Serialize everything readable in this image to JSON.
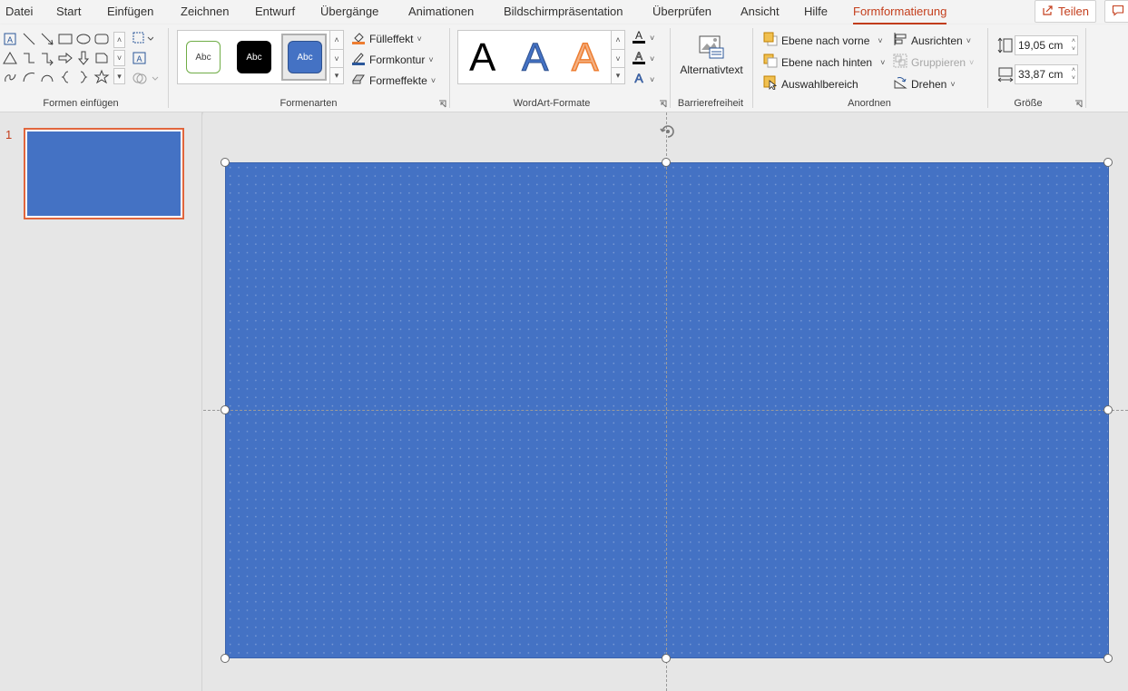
{
  "menu": {
    "tabs": [
      {
        "id": "datei",
        "label": "Datei"
      },
      {
        "id": "start",
        "label": "Start"
      },
      {
        "id": "einfuegen",
        "label": "Einfügen"
      },
      {
        "id": "zeichnen",
        "label": "Zeichnen"
      },
      {
        "id": "entwurf",
        "label": "Entwurf"
      },
      {
        "id": "uebergaenge",
        "label": "Übergänge"
      },
      {
        "id": "animationen",
        "label": "Animationen"
      },
      {
        "id": "bildschirm",
        "label": "Bildschirmpräsentation"
      },
      {
        "id": "ueberpruefen",
        "label": "Überprüfen"
      },
      {
        "id": "ansicht",
        "label": "Ansicht"
      },
      {
        "id": "hilfe",
        "label": "Hilfe"
      },
      {
        "id": "formformatierung",
        "label": "Formformatierung",
        "active": true
      }
    ],
    "share_label": "Teilen",
    "share_icon": "share-icon",
    "comment_icon": "comment-icon"
  },
  "ribbon": {
    "groups": {
      "formen_einfuegen": "Formen einfügen",
      "formenarten": "Formenarten",
      "wordart": "WordArt-Formate",
      "barrierefreiheit": "Barrierefreiheit",
      "anordnen": "Anordnen",
      "groesse": "Größe"
    },
    "shape_styles": [
      {
        "label": "Abc",
        "style": "outline-green"
      },
      {
        "label": "Abc",
        "style": "black-fill"
      },
      {
        "label": "Abc",
        "style": "blue-fill-selected"
      }
    ],
    "style_commands": {
      "fill": "Fülleffekt",
      "outline": "Formkontur",
      "effects": "Formeffekte"
    },
    "wordart_letters": [
      "A",
      "A",
      "A"
    ],
    "alt_text": "Alternativtext",
    "arrange": {
      "bring_forward": "Ebene nach vorne",
      "send_backward": "Ebene nach hinten",
      "selection_pane": "Auswahlbereich",
      "align": "Ausrichten",
      "group": "Gruppieren",
      "rotate": "Drehen"
    },
    "size": {
      "height": "19,05 cm",
      "width": "33,87 cm"
    }
  },
  "slides": {
    "current_number": "1",
    "thumbnail_color": "#4472c4"
  },
  "colors": {
    "accent": "#c43e1c",
    "shape_fill": "#4472c4",
    "selection_border": "#e1663d"
  }
}
